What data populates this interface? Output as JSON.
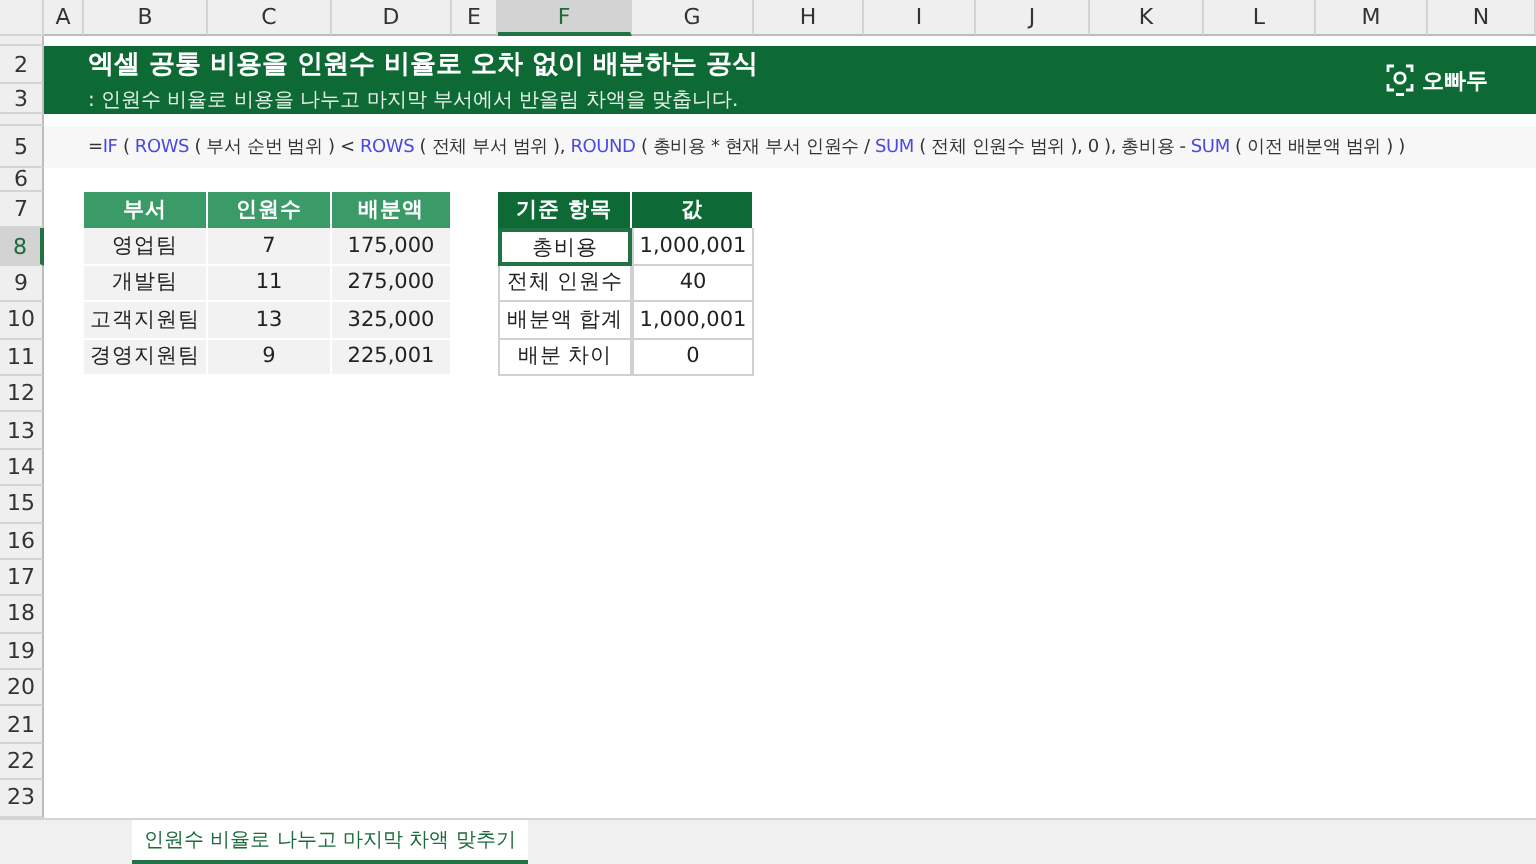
{
  "columns": [
    {
      "label": "A",
      "selected": false
    },
    {
      "label": "B",
      "selected": false
    },
    {
      "label": "C",
      "selected": false
    },
    {
      "label": "D",
      "selected": false
    },
    {
      "label": "E",
      "selected": false
    },
    {
      "label": "F",
      "selected": true
    },
    {
      "label": "G",
      "selected": false
    },
    {
      "label": "H",
      "selected": false
    },
    {
      "label": "I",
      "selected": false
    },
    {
      "label": "J",
      "selected": false
    },
    {
      "label": "K",
      "selected": false
    },
    {
      "label": "L",
      "selected": false
    },
    {
      "label": "M",
      "selected": false
    },
    {
      "label": "N",
      "selected": false
    }
  ],
  "row_headers": [
    {
      "label": "2",
      "selected": false
    },
    {
      "label": "3",
      "selected": false
    },
    {
      "label": "5",
      "selected": false
    },
    {
      "label": "6",
      "selected": false
    },
    {
      "label": "7",
      "selected": false
    },
    {
      "label": "8",
      "selected": true
    },
    {
      "label": "9",
      "selected": false
    },
    {
      "label": "10",
      "selected": false
    },
    {
      "label": "11",
      "selected": false
    },
    {
      "label": "12",
      "selected": false
    },
    {
      "label": "13",
      "selected": false
    },
    {
      "label": "14",
      "selected": false
    },
    {
      "label": "15",
      "selected": false
    },
    {
      "label": "16",
      "selected": false
    },
    {
      "label": "17",
      "selected": false
    },
    {
      "label": "18",
      "selected": false
    },
    {
      "label": "19",
      "selected": false
    },
    {
      "label": "20",
      "selected": false
    },
    {
      "label": "21",
      "selected": false
    },
    {
      "label": "22",
      "selected": false
    },
    {
      "label": "23",
      "selected": false
    }
  ],
  "banner": {
    "title": "엑셀 공통 비용을 인원수 비율로 오차 없이 배분하는 공식",
    "subtitle": ": 인원수 비율로 비용을 나누고 마지막 부서에서 반올림 차액을 맞춥니다.",
    "logo": "오빠두"
  },
  "formula": [
    {
      "kind": "text",
      "text": "="
    },
    {
      "kind": "function",
      "text": "IF"
    },
    {
      "kind": "text",
      "text": " ( "
    },
    {
      "kind": "function",
      "text": "ROWS"
    },
    {
      "kind": "text",
      "text": " ( 부서 순번 범위 ) < "
    },
    {
      "kind": "function",
      "text": "ROWS"
    },
    {
      "kind": "text",
      "text": " ( 전체 부서 범위 ), "
    },
    {
      "kind": "function",
      "text": "ROUND"
    },
    {
      "kind": "text",
      "text": " ( 총비용 * 현재 부서 인원수 / "
    },
    {
      "kind": "function",
      "text": "SUM"
    },
    {
      "kind": "text",
      "text": " ( 전체 인원수 범위 ), 0 ), 총비용 - "
    },
    {
      "kind": "function",
      "text": "SUM"
    },
    {
      "kind": "text",
      "text": " ( 이전 배분액 범위 ) )"
    }
  ],
  "department_table": {
    "columns": [
      "부서",
      "인원수",
      "배분액"
    ],
    "rows": [
      [
        "영업팀",
        "7",
        "175,000"
      ],
      [
        "개발팀",
        "11",
        "275,000"
      ],
      [
        "고객지원팀",
        "13",
        "325,000"
      ],
      [
        "경영지원팀",
        "9",
        "225,001"
      ]
    ]
  },
  "summary_table": {
    "columns": [
      "기준 항목",
      "값"
    ],
    "rows": [
      {
        "item": "총비용",
        "value": "1,000,001",
        "selected": true
      },
      {
        "item": "전체 인원수",
        "value": "40",
        "selected": false
      },
      {
        "item": "배분액 합계",
        "value": "1,000,001",
        "selected": false
      },
      {
        "item": "배분 차이",
        "value": "0",
        "selected": false
      }
    ]
  },
  "sheet_tabs": [
    {
      "label": "인원수 비율로 나누고 마지막 차액 맞추기",
      "selected": true
    }
  ]
}
